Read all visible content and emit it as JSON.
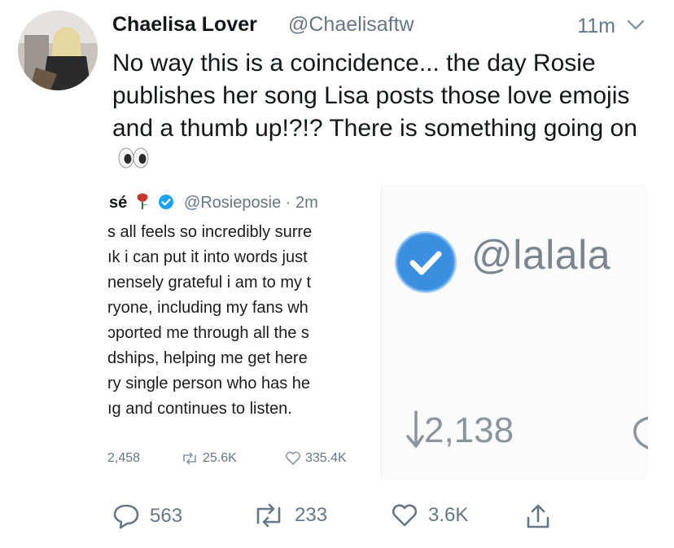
{
  "tweet": {
    "display_name": "Chaelisa Lover",
    "handle": "@Chaelisaftw",
    "time": "11m",
    "text": "No way this is a coincidence... the day Rosie publishes her song Lisa posts those love emojis and a thumb up!?!? There is something going on",
    "emoji": "eyes"
  },
  "left_screenshot": {
    "name_fragment": "sé",
    "emoji": "rose",
    "handle_time": "@Rosieposie · 2m",
    "lines": [
      "s all feels so incredibly surre",
      "ık i can put it into words just",
      "nensely grateful i am to my t",
      "ryone, including my fans wh",
      "ɔported me through all the s",
      "dships, helping me get here",
      "ry single person who has he",
      "ıg and continues to listen."
    ],
    "stats": {
      "replies": "2,458",
      "retweets": "25.6K",
      "likes": "335.4K"
    }
  },
  "right_screenshot": {
    "handle": "@lalala",
    "count": "2,138"
  },
  "actions": {
    "replies": "563",
    "retweets": "233",
    "likes": "3.6K"
  },
  "colors": {
    "primary_text": "#14171a",
    "secondary_text": "#657786",
    "verified_blue": "#1da1f2",
    "rose_red": "#c0392b"
  },
  "icons": [
    "chevron-down-icon",
    "eyes-emoji",
    "rose-emoji",
    "verified-badge-icon",
    "reply-icon",
    "retweet-icon",
    "like-icon",
    "share-icon"
  ]
}
